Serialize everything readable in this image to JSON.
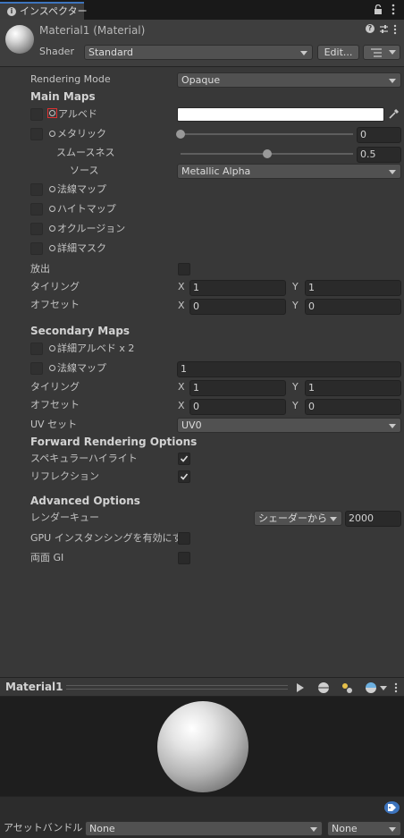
{
  "tab": {
    "title": "インスペクター"
  },
  "header": {
    "material_name": "Material1 (Material)",
    "shader_label": "Shader",
    "shader_value": "Standard",
    "edit_label": "Edit..."
  },
  "rendering_mode": {
    "label": "Rendering Mode",
    "value": "Opaque"
  },
  "main_maps": {
    "title": "Main Maps",
    "albedo": "アルベド",
    "metallic": "メタリック",
    "metallic_value": "0",
    "metallic_fraction": 0,
    "smoothness": "スムースネス",
    "smoothness_value": "0.5",
    "smoothness_fraction": 0.5,
    "source": "ソース",
    "source_value": "Metallic Alpha",
    "normal_map": "法線マップ",
    "height_map": "ハイトマップ",
    "occlusion": "オクルージョン",
    "detail_mask": "詳細マスク",
    "emission": "放出",
    "tiling": "タイリング",
    "tiling_x": "1",
    "tiling_y": "1",
    "offset": "オフセット",
    "offset_x": "0",
    "offset_y": "0",
    "x_label": "X",
    "y_label": "Y"
  },
  "secondary_maps": {
    "title": "Secondary Maps",
    "detail_albedo": "詳細アルベド x 2",
    "normal_map": "法線マップ",
    "normal_value": "1",
    "tiling": "タイリング",
    "tiling_x": "1",
    "tiling_y": "1",
    "offset": "オフセット",
    "offset_x": "0",
    "offset_y": "0",
    "uv_set": "UV セット",
    "uv_value": "UV0"
  },
  "forward": {
    "title": "Forward Rendering Options",
    "specular": "スペキュラーハイライト",
    "specular_checked": true,
    "reflections": "リフレクション",
    "reflections_checked": true
  },
  "advanced": {
    "title": "Advanced Options",
    "render_queue": "レンダーキュー",
    "queue_mode": "シェーダーから",
    "queue_value": "2000",
    "gpu_instancing": "GPU インスタンシングを有効にする",
    "double_sided_gi": "両面 GI"
  },
  "preview": {
    "title": "Material1"
  },
  "asset_bundle": {
    "label": "アセットバンドル",
    "name": "None",
    "variant": "None"
  },
  "colors": {
    "accent": "#3d74bd",
    "albedo_color": "#ffffff",
    "highlight_border": "#e03131"
  }
}
